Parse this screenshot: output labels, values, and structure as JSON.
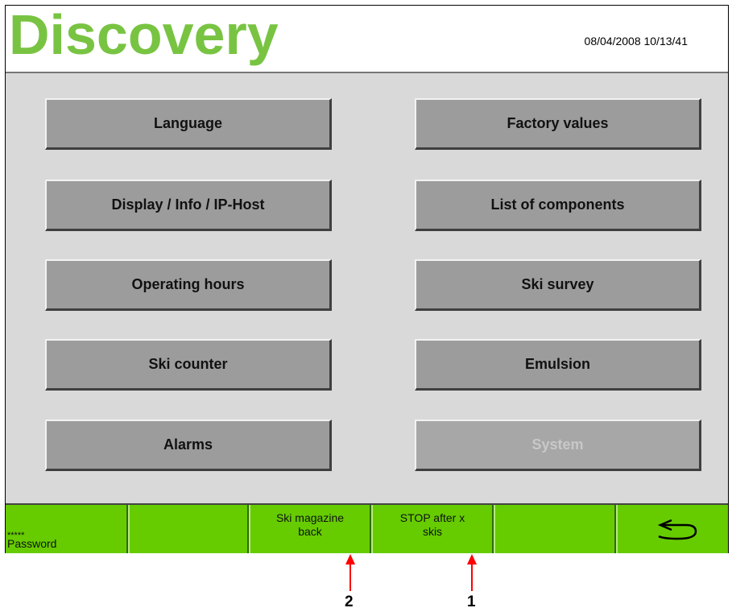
{
  "header": {
    "brand": "Discovery",
    "datetime": "08/04/2008 10/13/41"
  },
  "menu": {
    "language": "Language",
    "factory_values": "Factory values",
    "display_info": "Display / Info / IP-Host",
    "list_components": "List of components",
    "operating_hours": "Operating hours",
    "ski_survey": "Ski survey",
    "ski_counter": "Ski counter",
    "emulsion": "Emulsion",
    "alarms": "Alarms",
    "system": "System"
  },
  "footer": {
    "password_stars": "*****",
    "password_label": "Password",
    "ski_magazine_line1": "Ski magazine",
    "ski_magazine_line2": "back",
    "stop_line1": "STOP after x",
    "stop_line2": "skis",
    "back_icon": "back-arrow-icon"
  },
  "annotations": {
    "label_2": "2",
    "label_1": "1",
    "arrow_color": "#ff0000"
  },
  "colors": {
    "brand": "#78c442",
    "footer": "#66cc00",
    "button": "#9c9c9c",
    "background": "#d9d9d9"
  }
}
